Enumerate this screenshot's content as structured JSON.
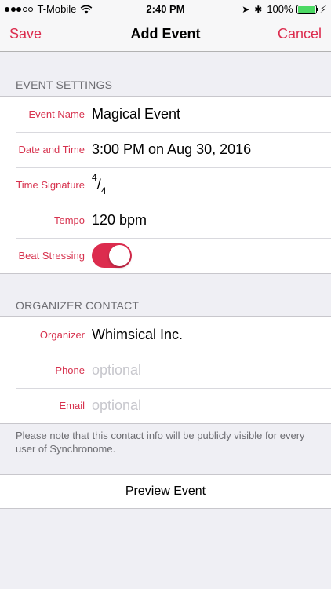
{
  "status_bar": {
    "carrier": "T-Mobile",
    "signal_dots": "●●●○○",
    "time": "2:40 PM",
    "battery_percent": "100%",
    "battery_level": 1.0,
    "location_glyph": "➤",
    "bluetooth_glyph": "✱",
    "bolt_glyph": "⚡"
  },
  "nav": {
    "left_button": "Save",
    "title": "Add Event",
    "right_button": "Cancel"
  },
  "event_settings": {
    "header": "EVENT SETTINGS",
    "event_name_label": "Event Name",
    "event_name_value": "Magical Event",
    "date_time_label": "Date and Time",
    "date_time_value": "3:00 PM on Aug 30, 2016",
    "time_signature_label": "Time Signature",
    "time_signature_numerator": "4",
    "time_signature_slash": "/",
    "time_signature_denominator": "4",
    "tempo_label": "Tempo",
    "tempo_value": "120 bpm",
    "beat_stressing_label": "Beat Stressing",
    "beat_stressing_on": true
  },
  "organizer_contact": {
    "header": "ORGANIZER CONTACT",
    "organizer_label": "Organizer",
    "organizer_value": "Whimsical Inc.",
    "phone_label": "Phone",
    "phone_placeholder": "optional",
    "email_label": "Email",
    "email_placeholder": "optional",
    "note": "Please note that this contact info will be publicly visible for every user of Synchronome."
  },
  "preview_button": "Preview Event",
  "colors": {
    "accent": "#dc2c4e",
    "background": "#efeff4",
    "battery": "#4cd964"
  }
}
